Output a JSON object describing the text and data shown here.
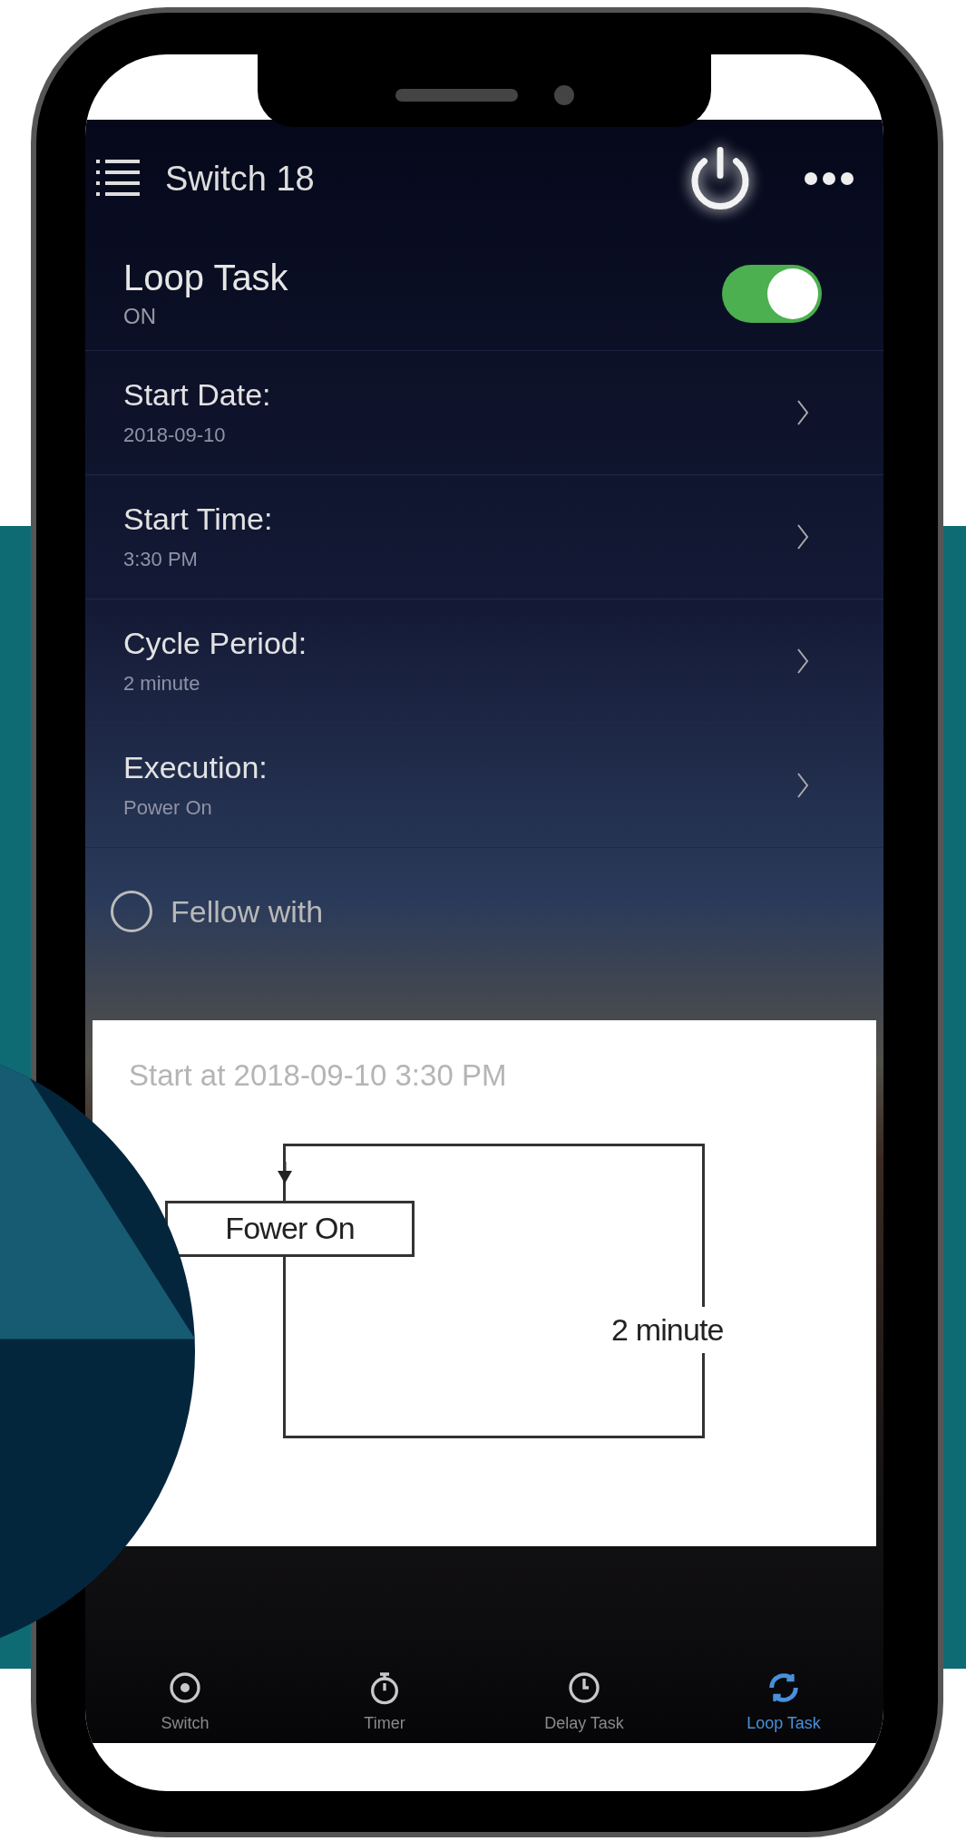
{
  "header": {
    "title": "Switch 18"
  },
  "loop_task": {
    "label": "Loop Task",
    "status": "ON",
    "on": true
  },
  "settings": [
    {
      "label": "Start Date:",
      "value": "2018-09-10"
    },
    {
      "label": "Start Time:",
      "value": "3:30 PM"
    },
    {
      "label": "Cycle Period:",
      "value": "2 minute"
    },
    {
      "label": "Execution:",
      "value": "Power On"
    }
  ],
  "follow": {
    "label": "Fellow with",
    "checked": false
  },
  "preview": {
    "caption": "Start at 2018-09-10 3:30 PM",
    "action": "Fower On",
    "period": "2 minute"
  },
  "tabs": [
    {
      "label": "Switch",
      "kind": "switch",
      "selected": false
    },
    {
      "label": "Timer",
      "kind": "timer",
      "selected": false
    },
    {
      "label": "Delay Task",
      "kind": "clock",
      "selected": false
    },
    {
      "label": "Loop Task",
      "kind": "loop",
      "selected": true
    }
  ]
}
